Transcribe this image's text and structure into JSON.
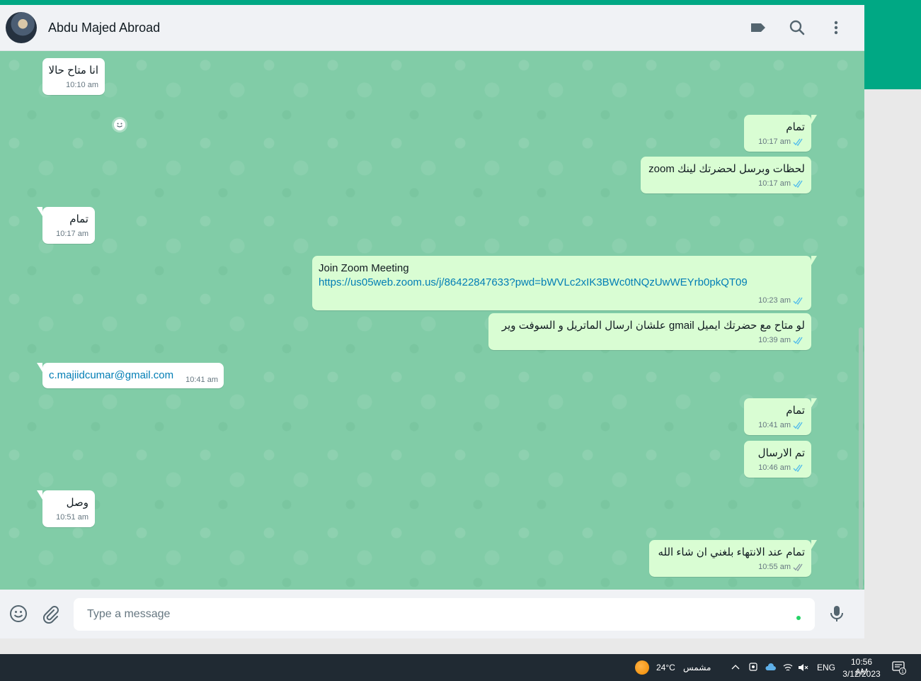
{
  "header": {
    "contact_name": "Abdu Majed Abroad"
  },
  "messages": [
    {
      "dir": "in",
      "text": "انا متاح حالا",
      "time": "10:10 am"
    },
    {
      "dir": "out",
      "text": "تمام",
      "time": "10:17 am"
    },
    {
      "dir": "out",
      "text": "لحظات وبرسل لحضرتك لينك zoom",
      "time": "10:17 am"
    },
    {
      "dir": "in",
      "text": "تمام",
      "time": "10:17 am"
    },
    {
      "dir": "out",
      "text": "Join Zoom Meeting",
      "link": "https://us05web.zoom.us/j/86422847633?pwd=bWVLc2xIK3BWc0tNQzUwWEYrb0pkQT09",
      "time": "10:23 am"
    },
    {
      "dir": "out",
      "text": "لو متاح مع حضرتك ايميل gmail  علشان ارسال الماتريل و السوفت وير",
      "time": "10:39 am"
    },
    {
      "dir": "in",
      "text": "c.majiidcumar@gmail.com",
      "time": "10:41 am"
    },
    {
      "dir": "out",
      "text": "تمام",
      "time": "10:41 am"
    },
    {
      "dir": "out",
      "text": "تم الارسال",
      "time": "10:46 am"
    },
    {
      "dir": "in",
      "text": "وصل",
      "time": "10:51 am"
    },
    {
      "dir": "out",
      "text": "تمام عند الانتهاء بلغني ان شاء الله",
      "time": "10:55 am"
    }
  ],
  "composer": {
    "placeholder": "Type a message"
  },
  "taskbar": {
    "temperature": "24°C",
    "weather_label": "مشمس",
    "language": "ENG",
    "time": "10:56 AM",
    "date": "3/12/2023",
    "notification_count": "1"
  },
  "colors": {
    "accent": "#00a884",
    "chat_background": "#81cca7",
    "outgoing_bubble": "#d9fdd3",
    "incoming_bubble": "#ffffff",
    "read_ticks": "#53bdeb",
    "delivered_ticks": "#8696a0",
    "taskbar": "#202a33"
  },
  "icons": {
    "header": [
      "label-icon",
      "search-icon",
      "menu-icon"
    ],
    "footer": [
      "emoji-icon",
      "attach-icon",
      "mic-icon"
    ],
    "taskbar": [
      "weather-icon",
      "chevron-icon",
      "meet-icon",
      "cloud-icon",
      "wifi-icon",
      "volume-icon",
      "notification-icon"
    ]
  }
}
